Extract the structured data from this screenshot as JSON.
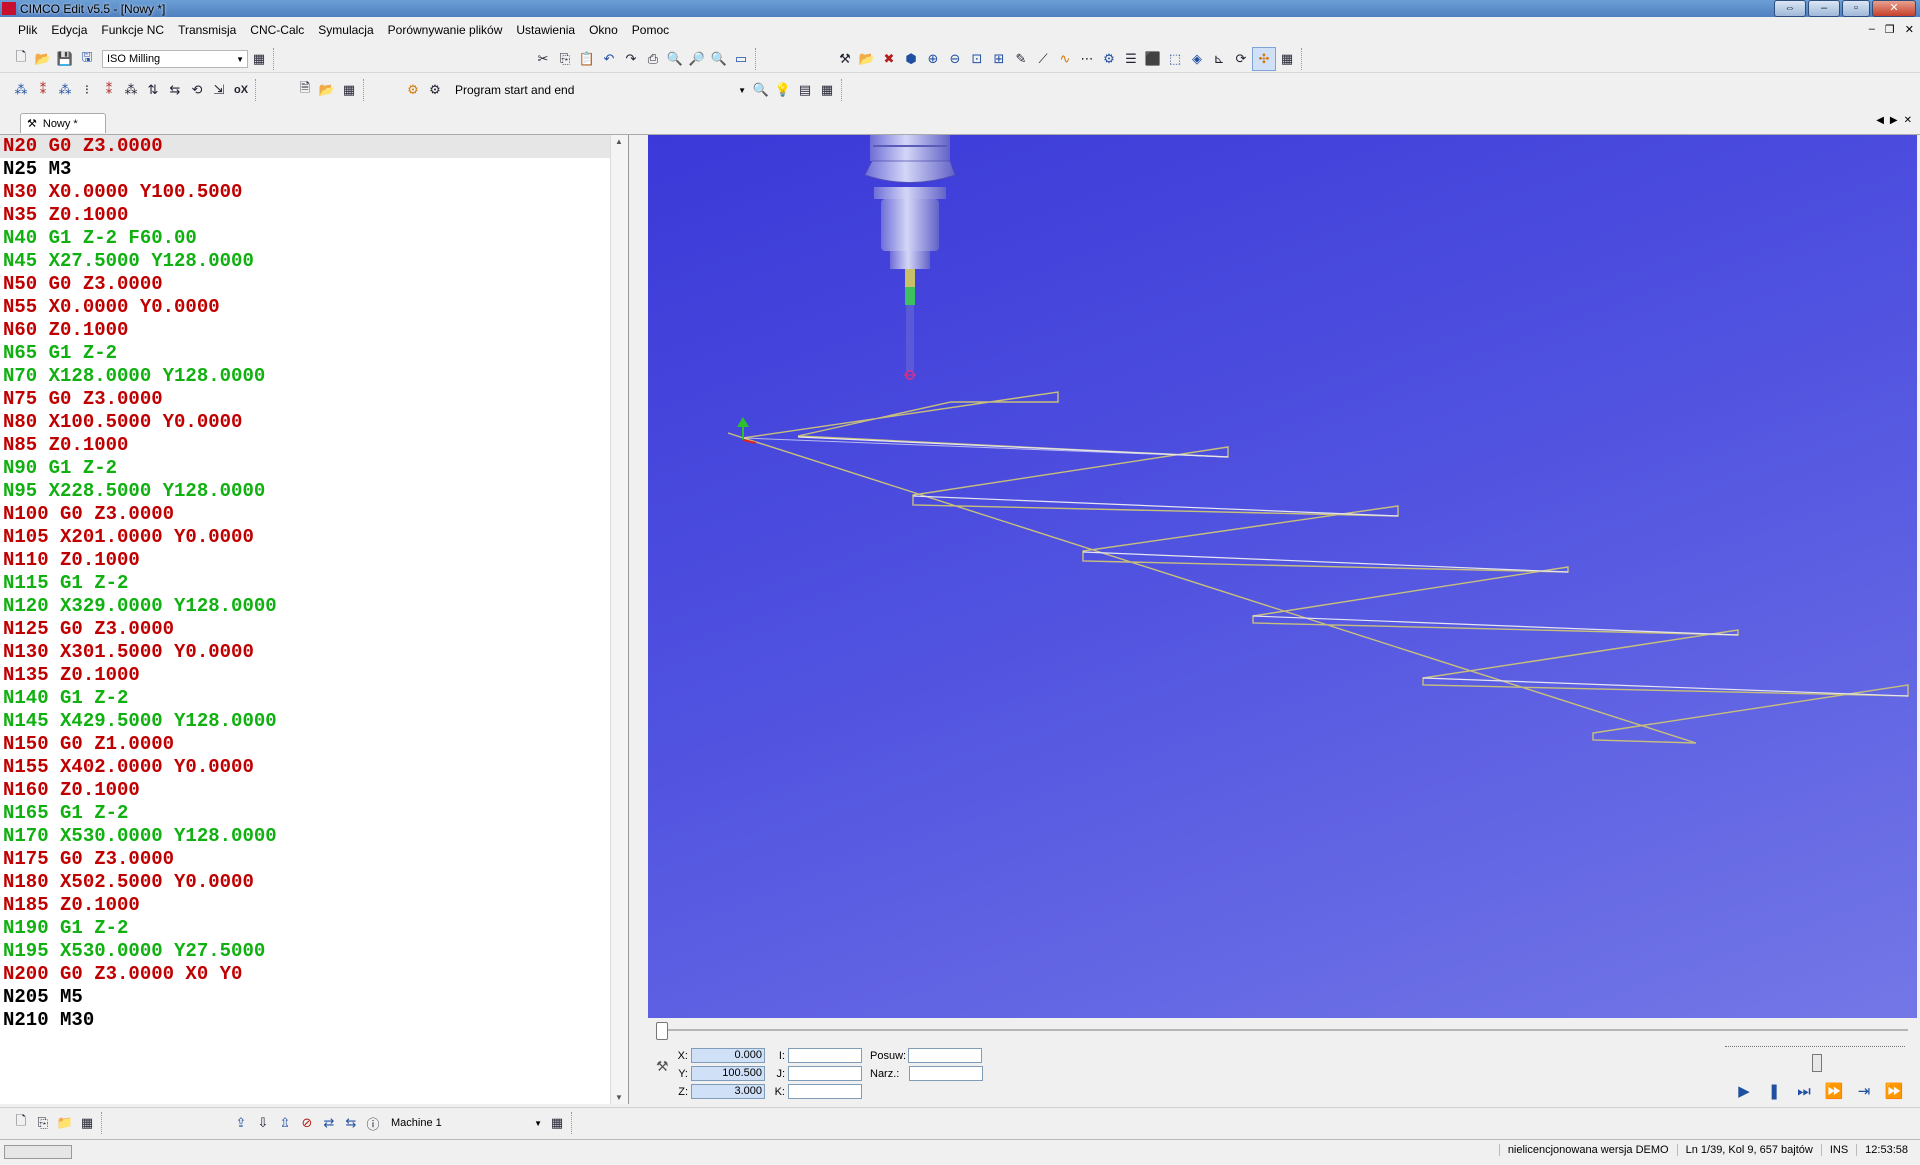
{
  "window": {
    "title": "CIMCO Edit v5.5 - [Nowy *]"
  },
  "menu": [
    "Plik",
    "Edycja",
    "Funkcje NC",
    "Transmisja",
    "CNC-Calc",
    "Symulacja",
    "Porównywanie plików",
    "Ustawienia",
    "Okno",
    "Pomoc"
  ],
  "toolbar": {
    "machine_type": "ISO Milling",
    "template": "Program start and end"
  },
  "tab": {
    "label": "Nowy *"
  },
  "editor": {
    "lines": [
      {
        "text": "N20 G0 Z3.0000",
        "color": "#c00000"
      },
      {
        "text": "N25 M3",
        "color": "#000000"
      },
      {
        "text": "N30 X0.0000 Y100.5000",
        "color": "#c00000"
      },
      {
        "text": "N35 Z0.1000",
        "color": "#c00000"
      },
      {
        "text": "N40 G1 Z-2 F60.00",
        "color": "#10b010"
      },
      {
        "text": "N45 X27.5000 Y128.0000",
        "color": "#10b010"
      },
      {
        "text": "N50 G0 Z3.0000",
        "color": "#c00000"
      },
      {
        "text": "N55 X0.0000 Y0.0000",
        "color": "#c00000"
      },
      {
        "text": "N60 Z0.1000",
        "color": "#c00000"
      },
      {
        "text": "N65 G1 Z-2",
        "color": "#10b010"
      },
      {
        "text": "N70 X128.0000 Y128.0000",
        "color": "#10b010"
      },
      {
        "text": "N75 G0 Z3.0000",
        "color": "#c00000"
      },
      {
        "text": "N80 X100.5000 Y0.0000",
        "color": "#c00000"
      },
      {
        "text": "N85 Z0.1000",
        "color": "#c00000"
      },
      {
        "text": "N90 G1 Z-2",
        "color": "#10b010"
      },
      {
        "text": "N95 X228.5000 Y128.0000",
        "color": "#10b010"
      },
      {
        "text": "N100 G0 Z3.0000",
        "color": "#c00000"
      },
      {
        "text": "N105 X201.0000 Y0.0000",
        "color": "#c00000"
      },
      {
        "text": "N110 Z0.1000",
        "color": "#c00000"
      },
      {
        "text": "N115 G1 Z-2",
        "color": "#10b010"
      },
      {
        "text": "N120 X329.0000 Y128.0000",
        "color": "#10b010"
      },
      {
        "text": "N125 G0 Z3.0000",
        "color": "#c00000"
      },
      {
        "text": "N130 X301.5000 Y0.0000",
        "color": "#c00000"
      },
      {
        "text": "N135 Z0.1000",
        "color": "#c00000"
      },
      {
        "text": "N140 G1 Z-2",
        "color": "#10b010"
      },
      {
        "text": "N145 X429.5000 Y128.0000",
        "color": "#10b010"
      },
      {
        "text": "N150 G0 Z1.0000",
        "color": "#c00000"
      },
      {
        "text": "N155 X402.0000 Y0.0000",
        "color": "#c00000"
      },
      {
        "text": "N160 Z0.1000",
        "color": "#c00000"
      },
      {
        "text": "N165 G1 Z-2",
        "color": "#10b010"
      },
      {
        "text": "N170 X530.0000 Y128.0000",
        "color": "#10b010"
      },
      {
        "text": "N175 G0 Z3.0000",
        "color": "#c00000"
      },
      {
        "text": "N180 X502.5000 Y0.0000",
        "color": "#c00000"
      },
      {
        "text": "N185 Z0.1000",
        "color": "#c00000"
      },
      {
        "text": "N190 G1 Z-2",
        "color": "#10b010"
      },
      {
        "text": "N195 X530.0000 Y27.5000",
        "color": "#10b010"
      },
      {
        "text": "N200 G0 Z3.0000 X0 Y0",
        "color": "#c00000"
      },
      {
        "text": "N205 M5",
        "color": "#000000"
      },
      {
        "text": "N210 M30",
        "color": "#000000"
      }
    ]
  },
  "sim": {
    "x_label": "X:",
    "x_value": "0.000",
    "y_label": "Y:",
    "y_value": "100.500",
    "z_label": "Z:",
    "z_value": "3.000",
    "i_label": "I:",
    "j_label": "J:",
    "k_label": "K:",
    "feed_label": "Posuw:",
    "tool_label": "Narz.:"
  },
  "bottom": {
    "machine": "Machine 1"
  },
  "status": {
    "license": "nielicencjonowana wersja DEMO",
    "position": "Ln 1/39, Kol 9, 657 bajtów",
    "mode": "INS",
    "time": "12:53:58"
  },
  "colors": {
    "viewport_top": "#3b39d8",
    "viewport_bottom": "#7377e6",
    "toolpath": "#c8c07a",
    "rapid": "#e0e0f0"
  }
}
